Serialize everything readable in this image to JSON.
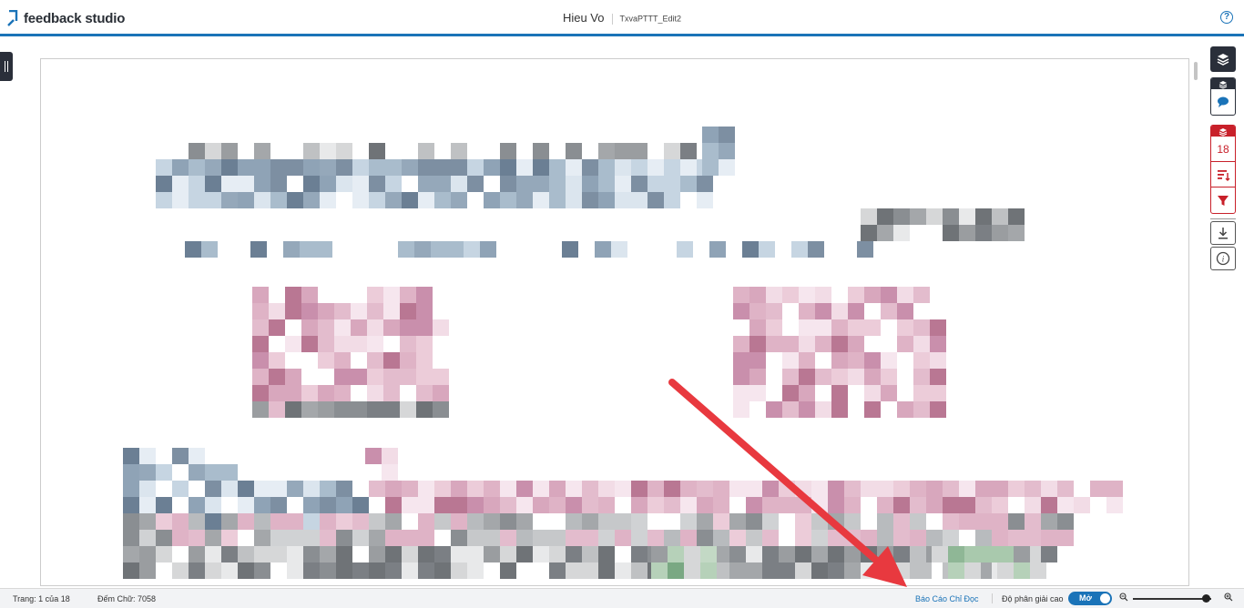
{
  "header": {
    "logo_text": "feedback studio",
    "author": "Hieu Vo",
    "document_name": "TxvaPTTT_Edit2",
    "help_icon": "?"
  },
  "toolbar": {
    "flag_count": "18"
  },
  "footer": {
    "page_info": "Trang: 1 của 18",
    "word_count": "Đếm Chữ: 7058",
    "readonly_report": "Báo Cáo Chỉ Đọc",
    "high_res_label": "Độ phân giải cao",
    "high_res_toggle": "Mở"
  },
  "colors": {
    "brand_blue": "#1a73b8",
    "toolbar_dark": "#2a2f3a",
    "flag_red": "#c8202a",
    "arrow_red": "#e8393f"
  }
}
